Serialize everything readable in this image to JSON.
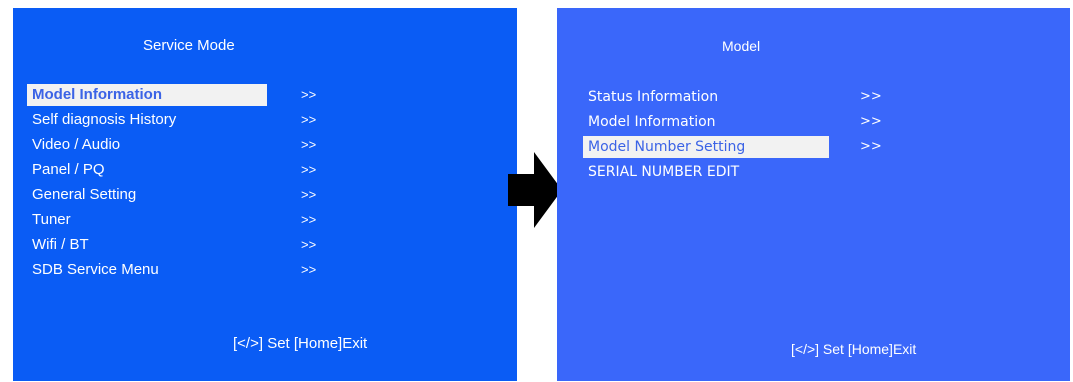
{
  "colors": {
    "left_panel_bg": "#0a5cf5",
    "right_panel_bg": "#3a67fa",
    "highlight_bg": "#f2f2f2",
    "highlight_text": "#3b63e6",
    "arrow": "#000000"
  },
  "left_panel": {
    "title": "Service Mode",
    "items": [
      {
        "label": "Model Information",
        "arrow": ">>",
        "selected": true
      },
      {
        "label": "Self diagnosis History",
        "arrow": ">>"
      },
      {
        "label": "Video / Audio",
        "arrow": ">>"
      },
      {
        "label": "Panel / PQ",
        "arrow": ">>"
      },
      {
        "label": "General Setting",
        "arrow": ">>"
      },
      {
        "label": "Tuner",
        "arrow": ">>"
      },
      {
        "label": "Wifi / BT",
        "arrow": ">>"
      },
      {
        "label": "SDB Service Menu",
        "arrow": ">>"
      }
    ],
    "footer": "[</>] Set [Home]Exit"
  },
  "right_panel": {
    "title": "Model",
    "items": [
      {
        "label": "Status Information",
        "arrow": ">>"
      },
      {
        "label": "Model Information",
        "arrow": ">>"
      },
      {
        "label": "Model Number Setting",
        "arrow": ">>",
        "selected": true
      },
      {
        "label": "SERIAL NUMBER EDIT",
        "arrow": ""
      }
    ],
    "footer": "[</>] Set [Home]Exit"
  },
  "transition_icon": "right-arrow-icon"
}
